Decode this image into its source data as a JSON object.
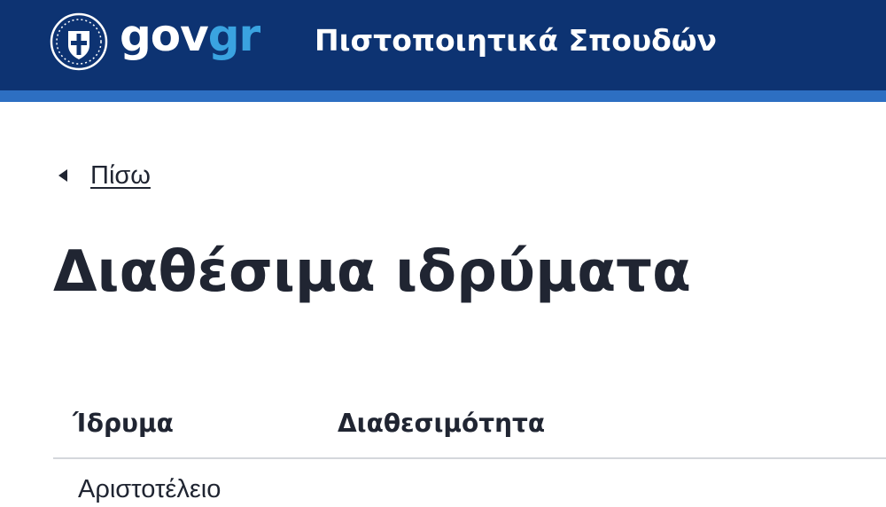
{
  "header": {
    "logo_gov": "gov",
    "logo_gr": "gr",
    "service_title": "Πιστοποιητικά Σπουδών"
  },
  "nav": {
    "back_label": "Πίσω"
  },
  "page": {
    "title": "Διαθέσιμα ιδρύματα"
  },
  "table": {
    "columns": [
      "Ίδρυμα",
      "Διαθεσιμότητα"
    ],
    "rows": [
      {
        "institution": "Αριστοτέλειο"
      }
    ]
  },
  "colors": {
    "header_bg": "#0d3372",
    "header_stripe": "#2d6fc2",
    "logo_accent": "#3aa3e0",
    "text": "#202532",
    "divider": "#d4d7dc"
  },
  "icons": {
    "emblem": "greek-coat-of-arms-icon",
    "back": "caret-left-icon"
  }
}
